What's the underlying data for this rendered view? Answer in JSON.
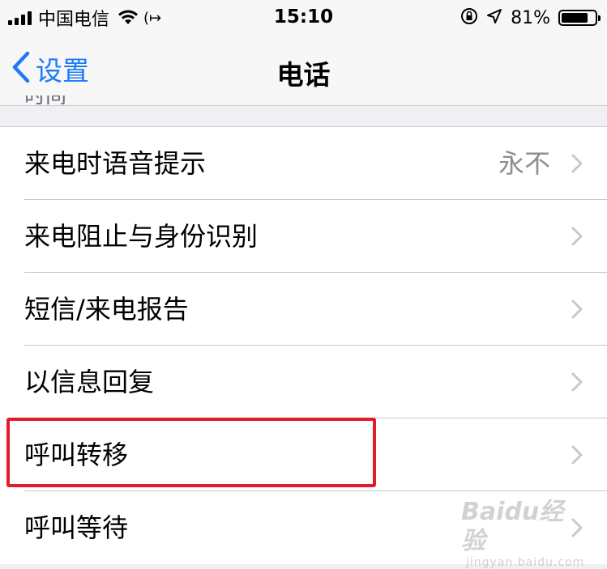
{
  "status_bar": {
    "carrier": "中国电信",
    "time": "15:10",
    "battery_percent": "81%",
    "battery_level": 0.81,
    "icons": [
      "signal-icon",
      "wifi-icon",
      "forward-arrow-icon",
      "rotation-lock-icon",
      "location-icon",
      "battery-icon"
    ]
  },
  "nav": {
    "back_label": "设置",
    "title": "电话"
  },
  "section_header_partial": "时间",
  "rows": [
    {
      "label": "来电时语音提示",
      "value": "永不"
    },
    {
      "label": "来电阻止与身份识别",
      "value": ""
    },
    {
      "label": "短信/来电报告",
      "value": ""
    },
    {
      "label": "以信息回复",
      "value": ""
    },
    {
      "label": "呼叫转移",
      "value": ""
    },
    {
      "label": "呼叫等待",
      "value": ""
    }
  ],
  "watermark": {
    "brand": "Baidu经验",
    "url": "jingyan.baidu.com"
  },
  "colors": {
    "accent": "#1f7af6",
    "highlight": "#e21c2b",
    "secondary_text": "#8e8e93",
    "background": "#efeff4"
  }
}
